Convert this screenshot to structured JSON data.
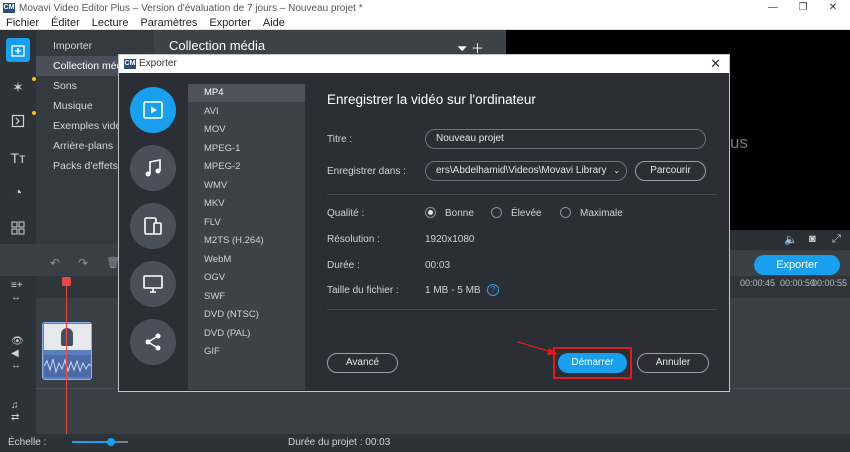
{
  "window": {
    "title": "Movavi Video Editor Plus – Version d'évaluation de 7 jours – Nouveau projet *",
    "icon_text": "CM"
  },
  "menu": [
    "Fichier",
    "Éditer",
    "Lecture",
    "Paramètres",
    "Exporter",
    "Aide"
  ],
  "leftnav": [
    "Importer",
    "Collection média",
    "Sons",
    "Musique",
    "Exemples vidéo",
    "Arrière-plans",
    "Packs d'effets"
  ],
  "collection": {
    "title": "Collection média"
  },
  "preview": {
    "overlay_text": "us"
  },
  "export_button": "Exporter",
  "timeline": {
    "ticks": [
      "00:00:45",
      "00:00:50",
      "00:00:55"
    ]
  },
  "status": {
    "scale_label": "Échelle :",
    "duration_label": "Durée du projet : 00:03",
    "scale_level": 0.7
  },
  "dialog": {
    "title": "Exporter",
    "categories": [
      "video-file-icon",
      "music-icon",
      "devices-icon",
      "monitor-icon",
      "share-icon"
    ],
    "formats": [
      "MP4",
      "AVI",
      "MOV",
      "MPEG-1",
      "MPEG-2",
      "WMV",
      "MKV",
      "FLV",
      "M2TS (H.264)",
      "WebM",
      "OGV",
      "SWF",
      "DVD (NTSC)",
      "DVD (PAL)",
      "GIF"
    ],
    "heading": "Enregistrer la vidéo sur l'ordinateur",
    "labels": {
      "title": "Titre :",
      "save_in": "Enregistrer dans :",
      "quality": "Qualité :",
      "resolution": "Résolution :",
      "duration": "Durée :",
      "filesize": "Taille du fichier :"
    },
    "title_value": "Nouveau projet",
    "save_path": "ers\\Abdelhamid\\Videos\\Movavi Library",
    "browse": "Parcourir",
    "quality_options": [
      "Bonne",
      "Élevée",
      "Maximale"
    ],
    "resolution_value": "1920x1080",
    "duration_value": "00:03",
    "filesize_value": "1 MB - 5 MB",
    "advanced": "Avancé",
    "start": "Démarrer",
    "cancel": "Annuler"
  },
  "colors": {
    "accent": "#18a0ef",
    "highlight": "#e01b1b",
    "dialog_bg": "#2b2f35"
  }
}
